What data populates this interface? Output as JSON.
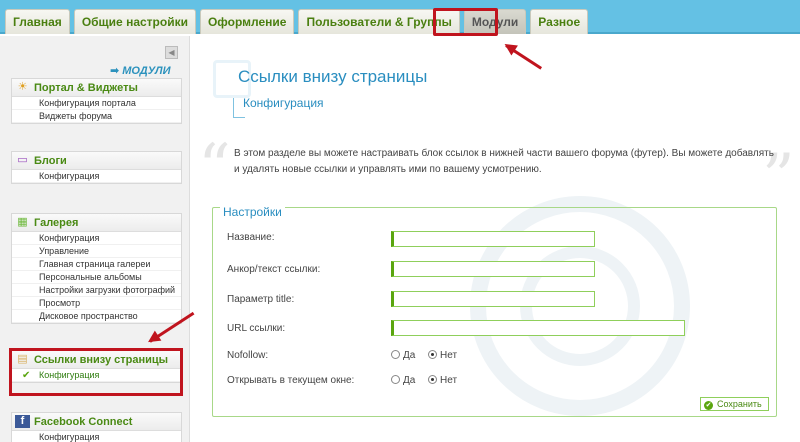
{
  "tabs": [
    "Главная",
    "Общие настройки",
    "Оформление",
    "Пользователи & Группы",
    "Модули",
    "Разное"
  ],
  "active_tab_index": 4,
  "sidebar": {
    "modules_label": "МОДУЛИ",
    "groups": [
      {
        "title": "Портал & Виджеты",
        "icon": "portal-icon",
        "items": [
          "Конфигурация портала",
          "Виджеты форума"
        ]
      },
      {
        "title": "Блоги",
        "icon": "blog-icon",
        "items": [
          "Конфигурация"
        ]
      },
      {
        "title": "Галерея",
        "icon": "gallery-icon",
        "items": [
          "Конфигурация",
          "Управление",
          "Главная страница галереи",
          "Персональные альбомы",
          "Настройки загрузки фотографий",
          "Просмотр",
          "Дисковое пространство"
        ]
      },
      {
        "title": "Ссылки внизу страницы",
        "icon": "footer-links-icon",
        "items": [
          "Конфигурация"
        ]
      },
      {
        "title": "Facebook Connect",
        "icon": "facebook-icon",
        "items": [
          "Конфигурация"
        ]
      }
    ]
  },
  "main": {
    "title": "Ссылки внизу страницы",
    "subtitle": "Конфигурация",
    "description": "В этом разделе вы можете настраивать блок ссылок в нижней части вашего форума (футер). Вы можете добавлять и удалять новые ссылки и управлять ими по вашему усмотрению.",
    "settings_legend": "Настройки",
    "fields": {
      "name_label": "Название:",
      "anchor_label": "Анкор/текст ссылки:",
      "title_param_label": "Параметр title:",
      "url_label": "URL ссылки:",
      "name_value": "",
      "anchor_value": "",
      "title_value": "",
      "url_value": ""
    },
    "nofollow_label": "Nofollow:",
    "newwindow_label": "Открывать в текущем окне:",
    "yes": "Да",
    "no": "Нет",
    "save_label": "Сохранить"
  },
  "colors": {
    "highlight": "#c0141e",
    "accent": "#2a8ec0",
    "green": "#5aa50f",
    "topbar": "#64c1e4"
  }
}
